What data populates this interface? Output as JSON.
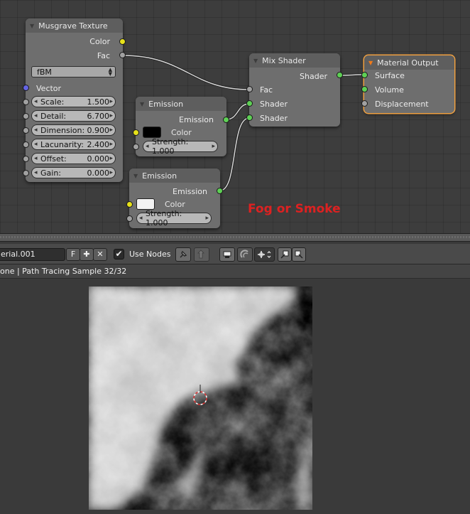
{
  "colors": {
    "node_body": "#6e6e6e",
    "node_header": "#5e5e5e",
    "socket_color": "#e7e21a",
    "socket_float": "#a1a1a1",
    "socket_shader": "#5ed055",
    "socket_vector": "#6464e4",
    "annotation": "#dd2121",
    "active_outline": "#f0a040"
  },
  "nodes": {
    "musgrave": {
      "title": "Musgrave Texture",
      "outputs": [
        "Color",
        "Fac"
      ],
      "type_select": "fBM",
      "vector_label": "Vector",
      "fields": [
        {
          "label": "Scale:",
          "value": "1.500"
        },
        {
          "label": "Detail:",
          "value": "6.700"
        },
        {
          "label": "Dimension:",
          "value": "0.900"
        },
        {
          "label": "Lacunarity:",
          "value": "2.400"
        },
        {
          "label": "Offset:",
          "value": "0.000"
        },
        {
          "label": "Gain:",
          "value": "0.000"
        }
      ]
    },
    "emission1": {
      "title": "Emission",
      "output": "Emission",
      "color_label": "Color",
      "color_value": "#000000",
      "strength": "Strength: 1.000"
    },
    "emission2": {
      "title": "Emission",
      "output": "Emission",
      "color_label": "Color",
      "color_value": "#f2f2f2",
      "strength": "Strength: 1.000"
    },
    "mix_shader": {
      "title": "Mix Shader",
      "output": "Shader",
      "inputs": [
        "Fac",
        "Shader",
        "Shader"
      ]
    },
    "material_output": {
      "title": "Material Output",
      "inputs": [
        "Surface",
        "Volume",
        "Displacement"
      ]
    }
  },
  "annotation": "Fog or Smoke",
  "header": {
    "material_name": "erial.001",
    "fake_user": "F",
    "add_icon": "plus-icon",
    "close_icon": "x-icon",
    "use_nodes_checked": true,
    "use_nodes_label": "Use Nodes"
  },
  "render_status": "one | Path Tracing Sample 32/32"
}
